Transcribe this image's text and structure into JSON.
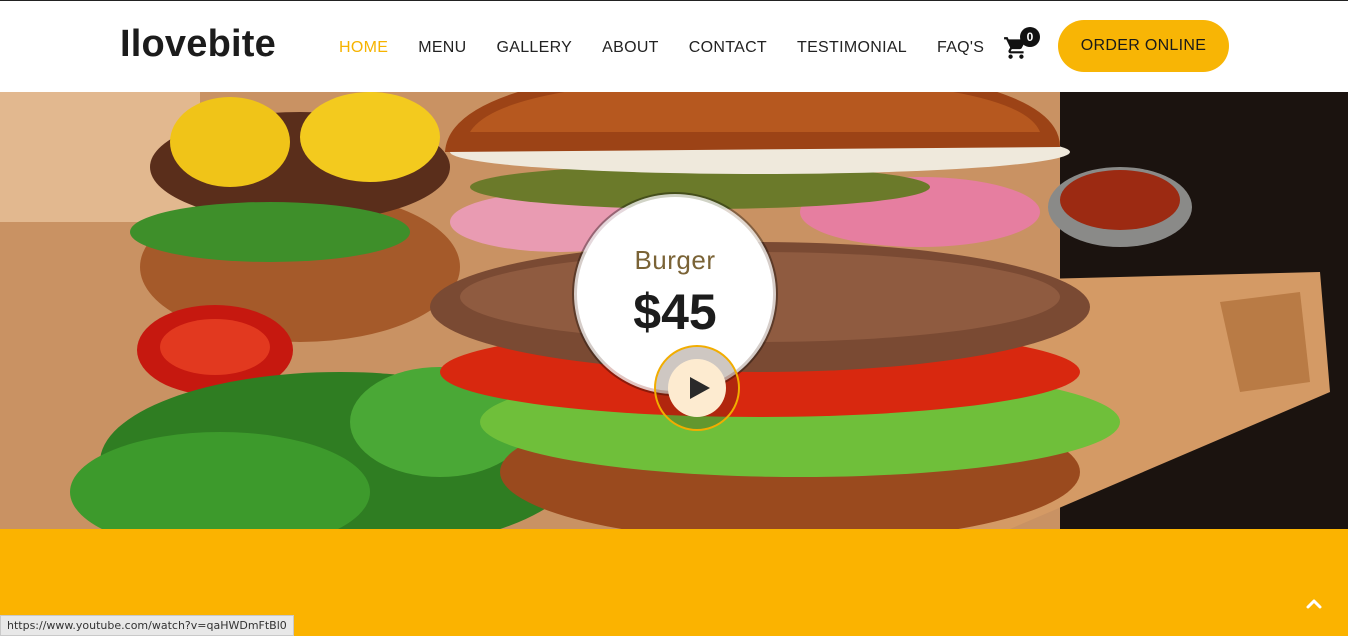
{
  "brand": {
    "logo": "Ilovebite"
  },
  "nav": {
    "items": [
      {
        "label": "HOME",
        "active": true
      },
      {
        "label": "MENU"
      },
      {
        "label": "GALLERY"
      },
      {
        "label": "ABOUT"
      },
      {
        "label": "CONTACT"
      },
      {
        "label": "TESTIMONIAL"
      },
      {
        "label": "FAQ'S"
      }
    ]
  },
  "cart": {
    "count": "0",
    "icon": "cart-icon"
  },
  "cta": {
    "label": "ORDER ONLINE"
  },
  "hero": {
    "item_name": "Burger",
    "price": "$45",
    "play_icon": "play-icon"
  },
  "status_bar": {
    "url": "https://www.youtube.com/watch?v=qaHWDmFtBl0"
  },
  "back_to_top": {
    "icon": "chevron-up-icon"
  },
  "colors": {
    "accent": "#f8b505",
    "band": "#fbb300",
    "text": "#1c1c1c"
  }
}
